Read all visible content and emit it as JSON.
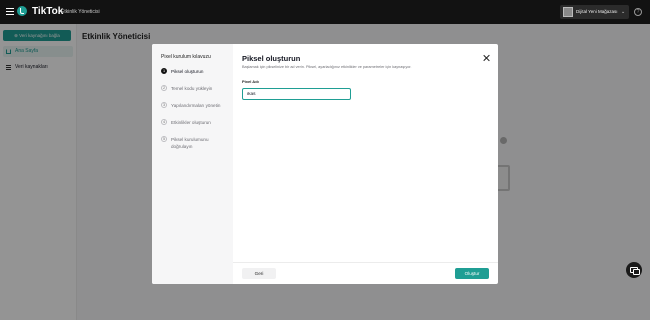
{
  "topbar": {
    "brand": "TikTok",
    "subtitle": "· Etkinlik Yöneticisi",
    "account_name": "Dijital Yeni Mağazası",
    "help_label": "?"
  },
  "sidebar": {
    "connect_button": "⊕ Veri kaynağını bağla",
    "items": [
      {
        "label": "Ana Sayfa",
        "icon": "home-icon"
      },
      {
        "label": "Veri kaynakları",
        "icon": "list-icon"
      }
    ]
  },
  "main": {
    "title": "Etkinlik Yöneticisi"
  },
  "modal": {
    "steps_title": "Pixel kurulum kılavuzu",
    "steps": [
      {
        "num": "1",
        "label": "Piksel oluşturun"
      },
      {
        "num": "2",
        "label": "Temel kodu yükleyin"
      },
      {
        "num": "3",
        "label": "Yapılandırmaları yönetin"
      },
      {
        "num": "4",
        "label": "Etkinlikler oluşturun"
      },
      {
        "num": "5",
        "label": "Piksel kurulumunu doğrulayın"
      }
    ],
    "active_step": 1,
    "title": "Piksel oluşturun",
    "subtitle": "Başlamak için pikselinize bir ad verin. Piksel, ayarladığınız etkinlikler ve parametreler için kaynaşıyor.",
    "field_label": "Pixel Adı",
    "field_value": "ikas",
    "back_label": "Geri",
    "create_label": "Oluştur"
  },
  "colors": {
    "accent": "#1f9e94",
    "topbar": "#121212"
  }
}
